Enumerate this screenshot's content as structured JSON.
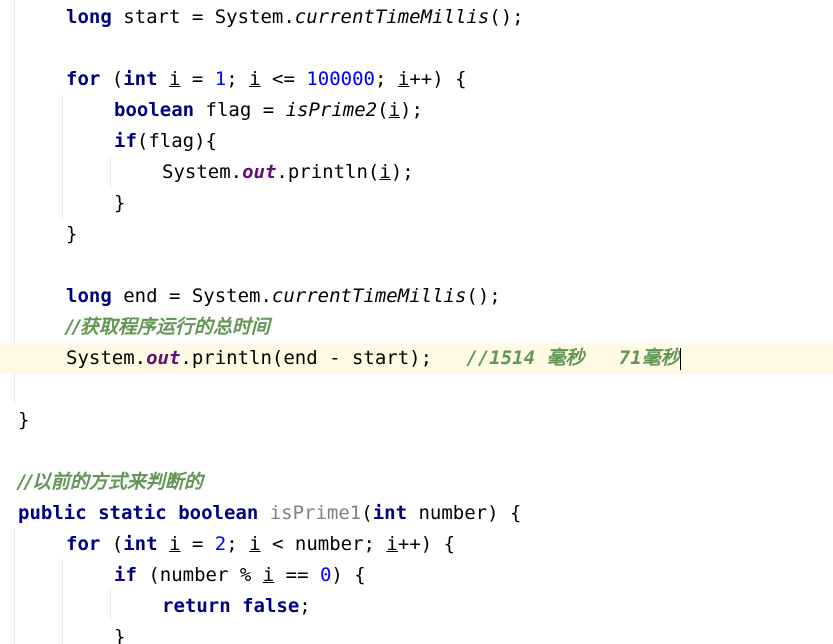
{
  "editor": {
    "lines": [
      {
        "id": "l1",
        "tokens": [
          "long",
          " start = System.",
          "currentTimeMillis",
          "();"
        ]
      },
      {
        "id": "l2",
        "tokens": []
      },
      {
        "id": "l3",
        "tokens": [
          "for",
          " (",
          "int",
          " ",
          "i",
          " = ",
          "1",
          "; ",
          "i",
          " <= ",
          "100000",
          "; ",
          "i",
          "++) {"
        ]
      },
      {
        "id": "l4",
        "tokens": [
          "boolean",
          " flag = ",
          "isPrime2",
          "(",
          "i",
          ");"
        ]
      },
      {
        "id": "l5",
        "tokens": [
          "if",
          "(flag){"
        ]
      },
      {
        "id": "l6",
        "tokens": [
          "System.",
          "out",
          ".println(",
          "i",
          ");"
        ]
      },
      {
        "id": "l7",
        "tokens": [
          "}"
        ]
      },
      {
        "id": "l8",
        "tokens": [
          "}"
        ]
      },
      {
        "id": "l9",
        "tokens": []
      },
      {
        "id": "l10",
        "tokens": [
          "long",
          " end = System.",
          "currentTimeMillis",
          "();"
        ]
      },
      {
        "id": "l11",
        "tokens": [
          "//获取程序运行的总时间"
        ]
      },
      {
        "id": "l12",
        "tokens": [
          "System.",
          "out",
          ".println(end - start);   ",
          "//1514 毫秒   71毫秒"
        ]
      },
      {
        "id": "l13",
        "tokens": []
      },
      {
        "id": "l14",
        "tokens": [
          "}"
        ]
      },
      {
        "id": "l15",
        "tokens": []
      },
      {
        "id": "l16",
        "tokens": [
          "//以前的方式来判断的"
        ]
      },
      {
        "id": "l17",
        "tokens": [
          "public",
          " ",
          "static",
          " ",
          "boolean",
          " ",
          "isPrime1",
          "(",
          "int",
          " number) {"
        ]
      },
      {
        "id": "l18",
        "tokens": [
          "for",
          " (",
          "int",
          " ",
          "i",
          " = ",
          "2",
          "; ",
          "i",
          " < number; ",
          "i",
          "++) {"
        ]
      },
      {
        "id": "l19",
        "tokens": [
          "if",
          " (number % ",
          "i",
          " == ",
          "0",
          ") {"
        ]
      },
      {
        "id": "l20",
        "tokens": [
          "return",
          " ",
          "false",
          ";"
        ]
      },
      {
        "id": "l21",
        "tokens": [
          "}"
        ]
      }
    ]
  },
  "colors": {
    "keyword": "#000080",
    "number": "#0000ff",
    "field": "#660e7a",
    "comment": "#808080",
    "todo_comment": "#629755",
    "current_line": "#fffae3"
  }
}
